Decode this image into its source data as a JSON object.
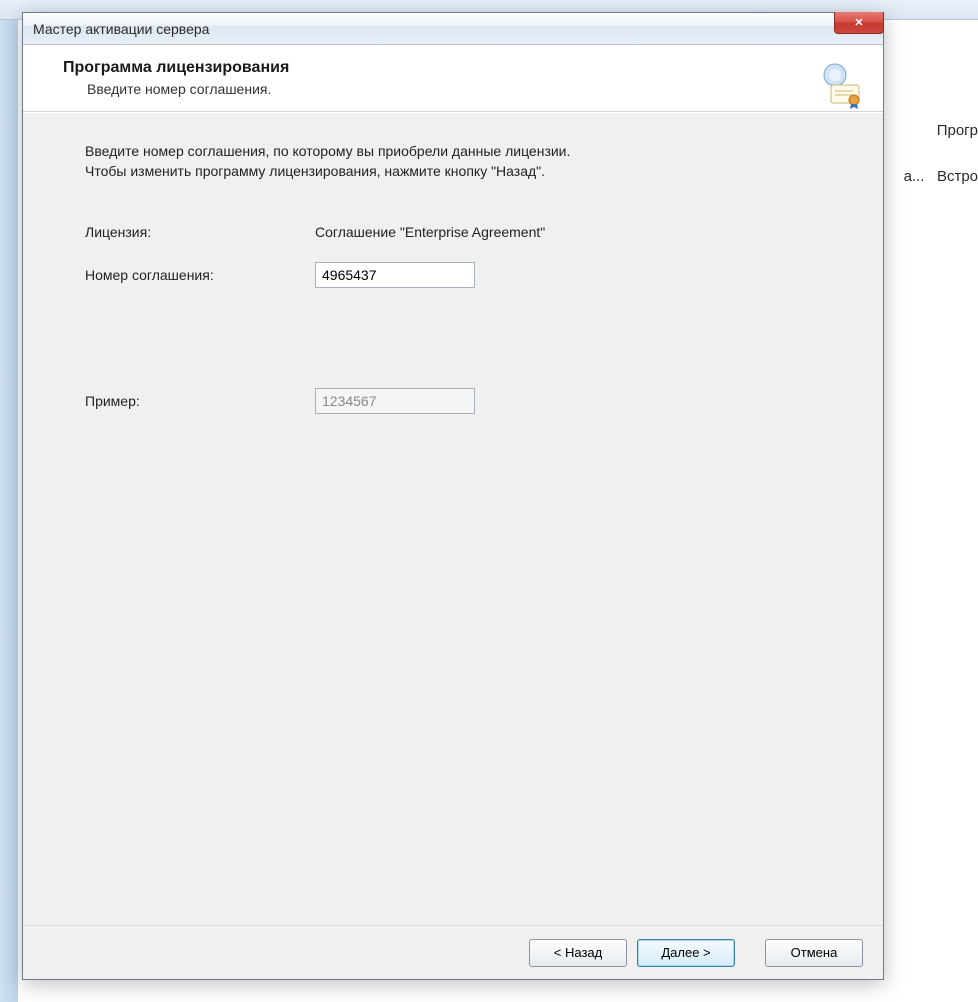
{
  "background": {
    "col_header_1": "Прогр",
    "row_trunc_1": "а...",
    "row_trunc_2": "Встро"
  },
  "dialog": {
    "title": "Мастер активации сервера",
    "header_title": "Программа лицензирования",
    "header_subtitle": "Введите номер соглашения.",
    "instruction_line1": "Введите номер соглашения, по которому вы приобрели данные лицензии.",
    "instruction_line2": "Чтобы изменить программу лицензирования, нажмите кнопку \"Назад\".",
    "form": {
      "license_label": "Лицензия:",
      "license_value": "Соглашение \"Enterprise Agreement\"",
      "agreement_label": "Номер соглашения:",
      "agreement_value": "4965437",
      "example_label": "Пример:",
      "example_value": "1234567"
    },
    "buttons": {
      "back": "< Назад",
      "next": "Далее >",
      "cancel": "Отмена"
    }
  }
}
